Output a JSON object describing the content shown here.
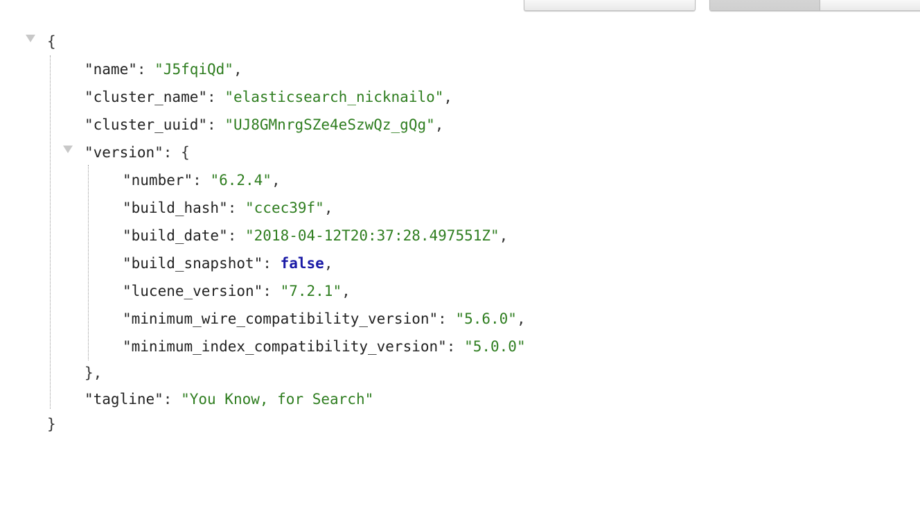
{
  "toolbar": {
    "left_button_label": "",
    "segment_left_label": "",
    "segment_right_label": ""
  },
  "json": {
    "root_open": "{",
    "root_close": "}",
    "top_fields": [
      {
        "key": "\"name\"",
        "value": "\"J5fqiQd\"",
        "trail": ","
      },
      {
        "key": "\"cluster_name\"",
        "value": "\"elasticsearch_nicknailo\"",
        "trail": ","
      },
      {
        "key": "\"cluster_uuid\"",
        "value": "\"UJ8GMnrgSZe4eSzwQz_gQg\"",
        "trail": ","
      }
    ],
    "version": {
      "key": "\"version\"",
      "open": "{",
      "close": "},",
      "fields": [
        {
          "key": "\"number\"",
          "value": "\"6.2.4\"",
          "type": "string",
          "trail": ","
        },
        {
          "key": "\"build_hash\"",
          "value": "\"ccec39f\"",
          "type": "string",
          "trail": ","
        },
        {
          "key": "\"build_date\"",
          "value": "\"2018-04-12T20:37:28.497551Z\"",
          "type": "string",
          "trail": ","
        },
        {
          "key": "\"build_snapshot\"",
          "value": "false",
          "type": "bool",
          "trail": ","
        },
        {
          "key": "\"lucene_version\"",
          "value": "\"7.2.1\"",
          "type": "string",
          "trail": ","
        },
        {
          "key": "\"minimum_wire_compatibility_version\"",
          "value": "\"5.6.0\"",
          "type": "string",
          "trail": ","
        },
        {
          "key": "\"minimum_index_compatibility_version\"",
          "value": "\"5.0.0\"",
          "type": "string",
          "trail": ""
        }
      ]
    },
    "tagline": {
      "key": "\"tagline\"",
      "value": "\"You Know, for Search\"",
      "trail": ""
    }
  },
  "colors": {
    "string": "#2e7d1f",
    "boolean": "#1a1aa6",
    "key": "#222222"
  }
}
